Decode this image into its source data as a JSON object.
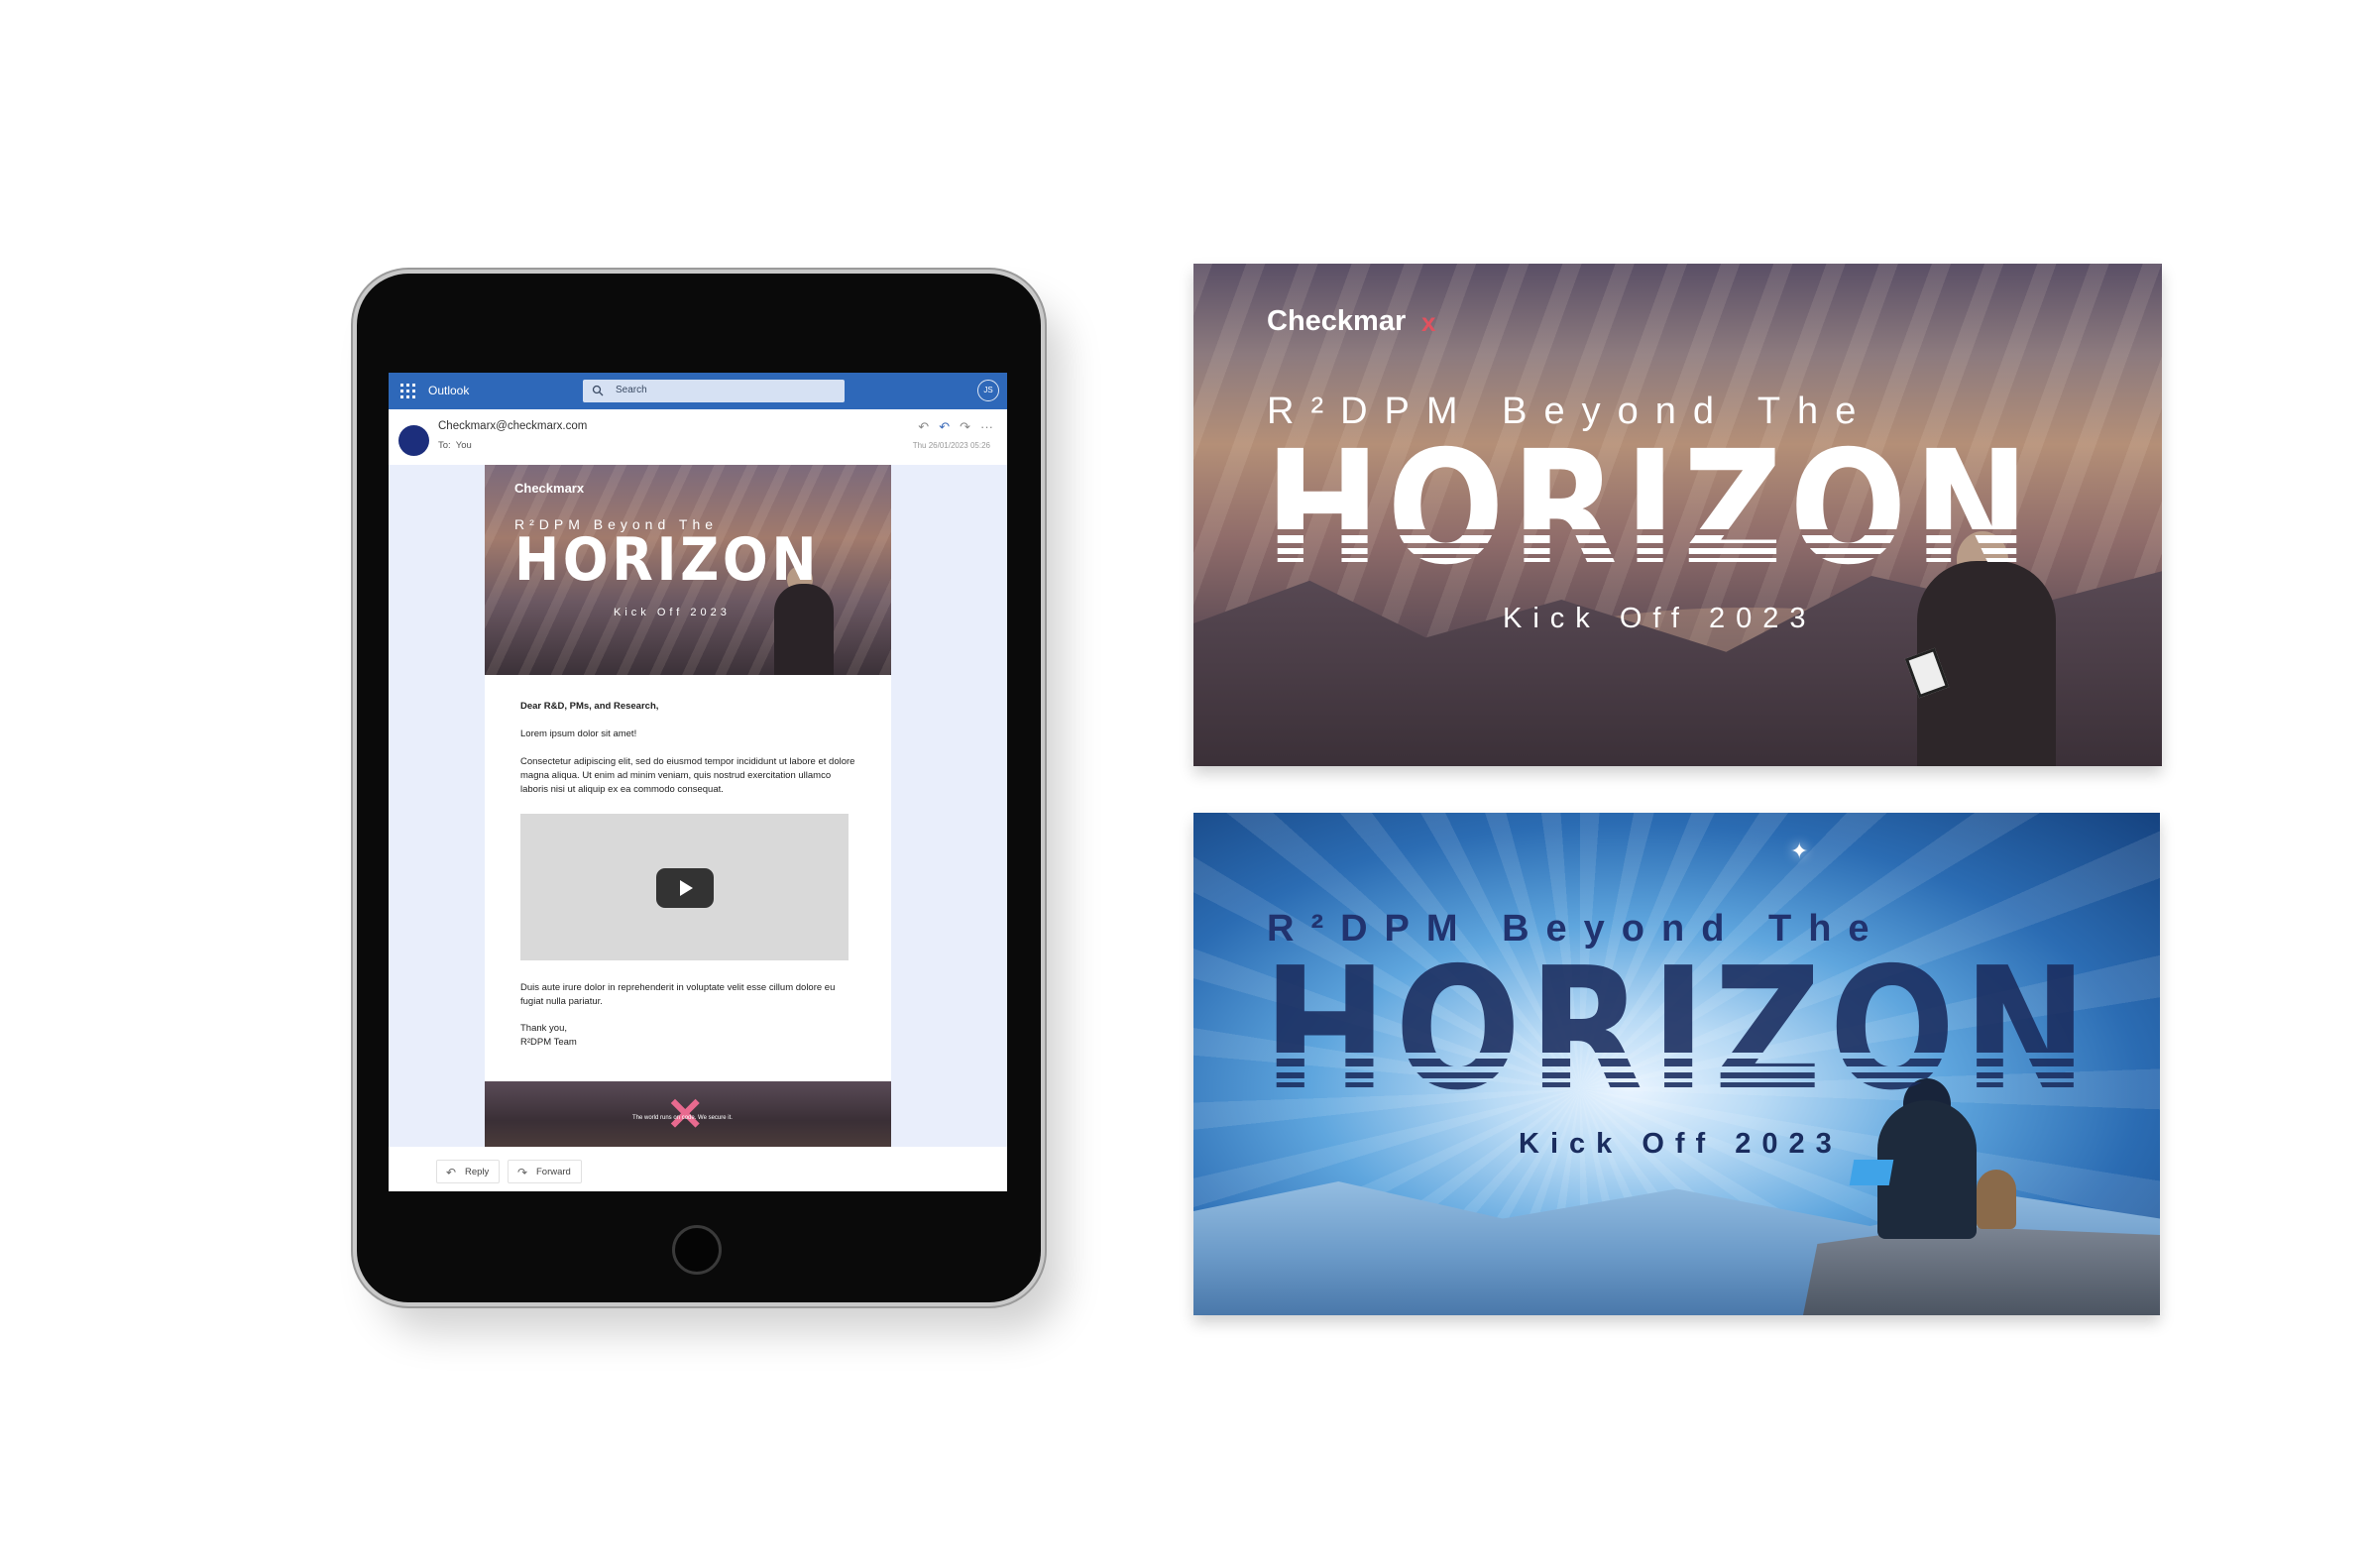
{
  "outlook": {
    "app_name": "Outlook",
    "search_placeholder": "Search",
    "user_initials": "JS",
    "sender": "Checkmarx@checkmarx.com",
    "to_label": "To:",
    "to_value": "You",
    "date": "Thu 26/01/2023 05:26",
    "icons": [
      "waffle-icon",
      "search-icon",
      "reply-icon",
      "reply-all-icon",
      "forward-icon",
      "more-icon"
    ],
    "email": {
      "hero_brand": "Checkmarx",
      "hero_subtitle": "R²DPM Beyond The",
      "hero_title": "HORIZON",
      "hero_kicker": "Kick Off 2023",
      "greeting": "Dear R&D, PMs, and Research,",
      "line1": "Lorem ipsum dolor sit amet!",
      "para1": "Consectetur adipiscing elit, sed do eiusmod tempor incididunt ut labore et dolore magna aliqua. Ut enim ad minim veniam, quis nostrud exercitation ullamco laboris nisi ut aliquip ex ea commodo consequat.",
      "para2": "Duis aute irure dolor in reprehenderit in voluptate velit esse cillum dolore eu fugiat nulla pariatur.",
      "signoff": "Thank you,",
      "signature": "R²DPM Team",
      "footer_tagline": "The world runs on code. We secure it."
    },
    "reply_label": "Reply",
    "forward_label": "Forward"
  },
  "banner_sunset": {
    "brand": "Checkmar",
    "brand_x": "x",
    "sub": "R²DPM Beyond The",
    "title": "HORIZON",
    "kicker": "Kick Off 2023"
  },
  "banner_blue": {
    "sub": "R²DPM Beyond The",
    "title": "HORIZON",
    "kicker": "Kick Off 2023"
  },
  "colors": {
    "outlook_blue": "#2e68b9",
    "mail_background": "#e9eefb",
    "checkmarx_x": "#e0525f",
    "banner_blue_text": "#1a2c5e"
  }
}
